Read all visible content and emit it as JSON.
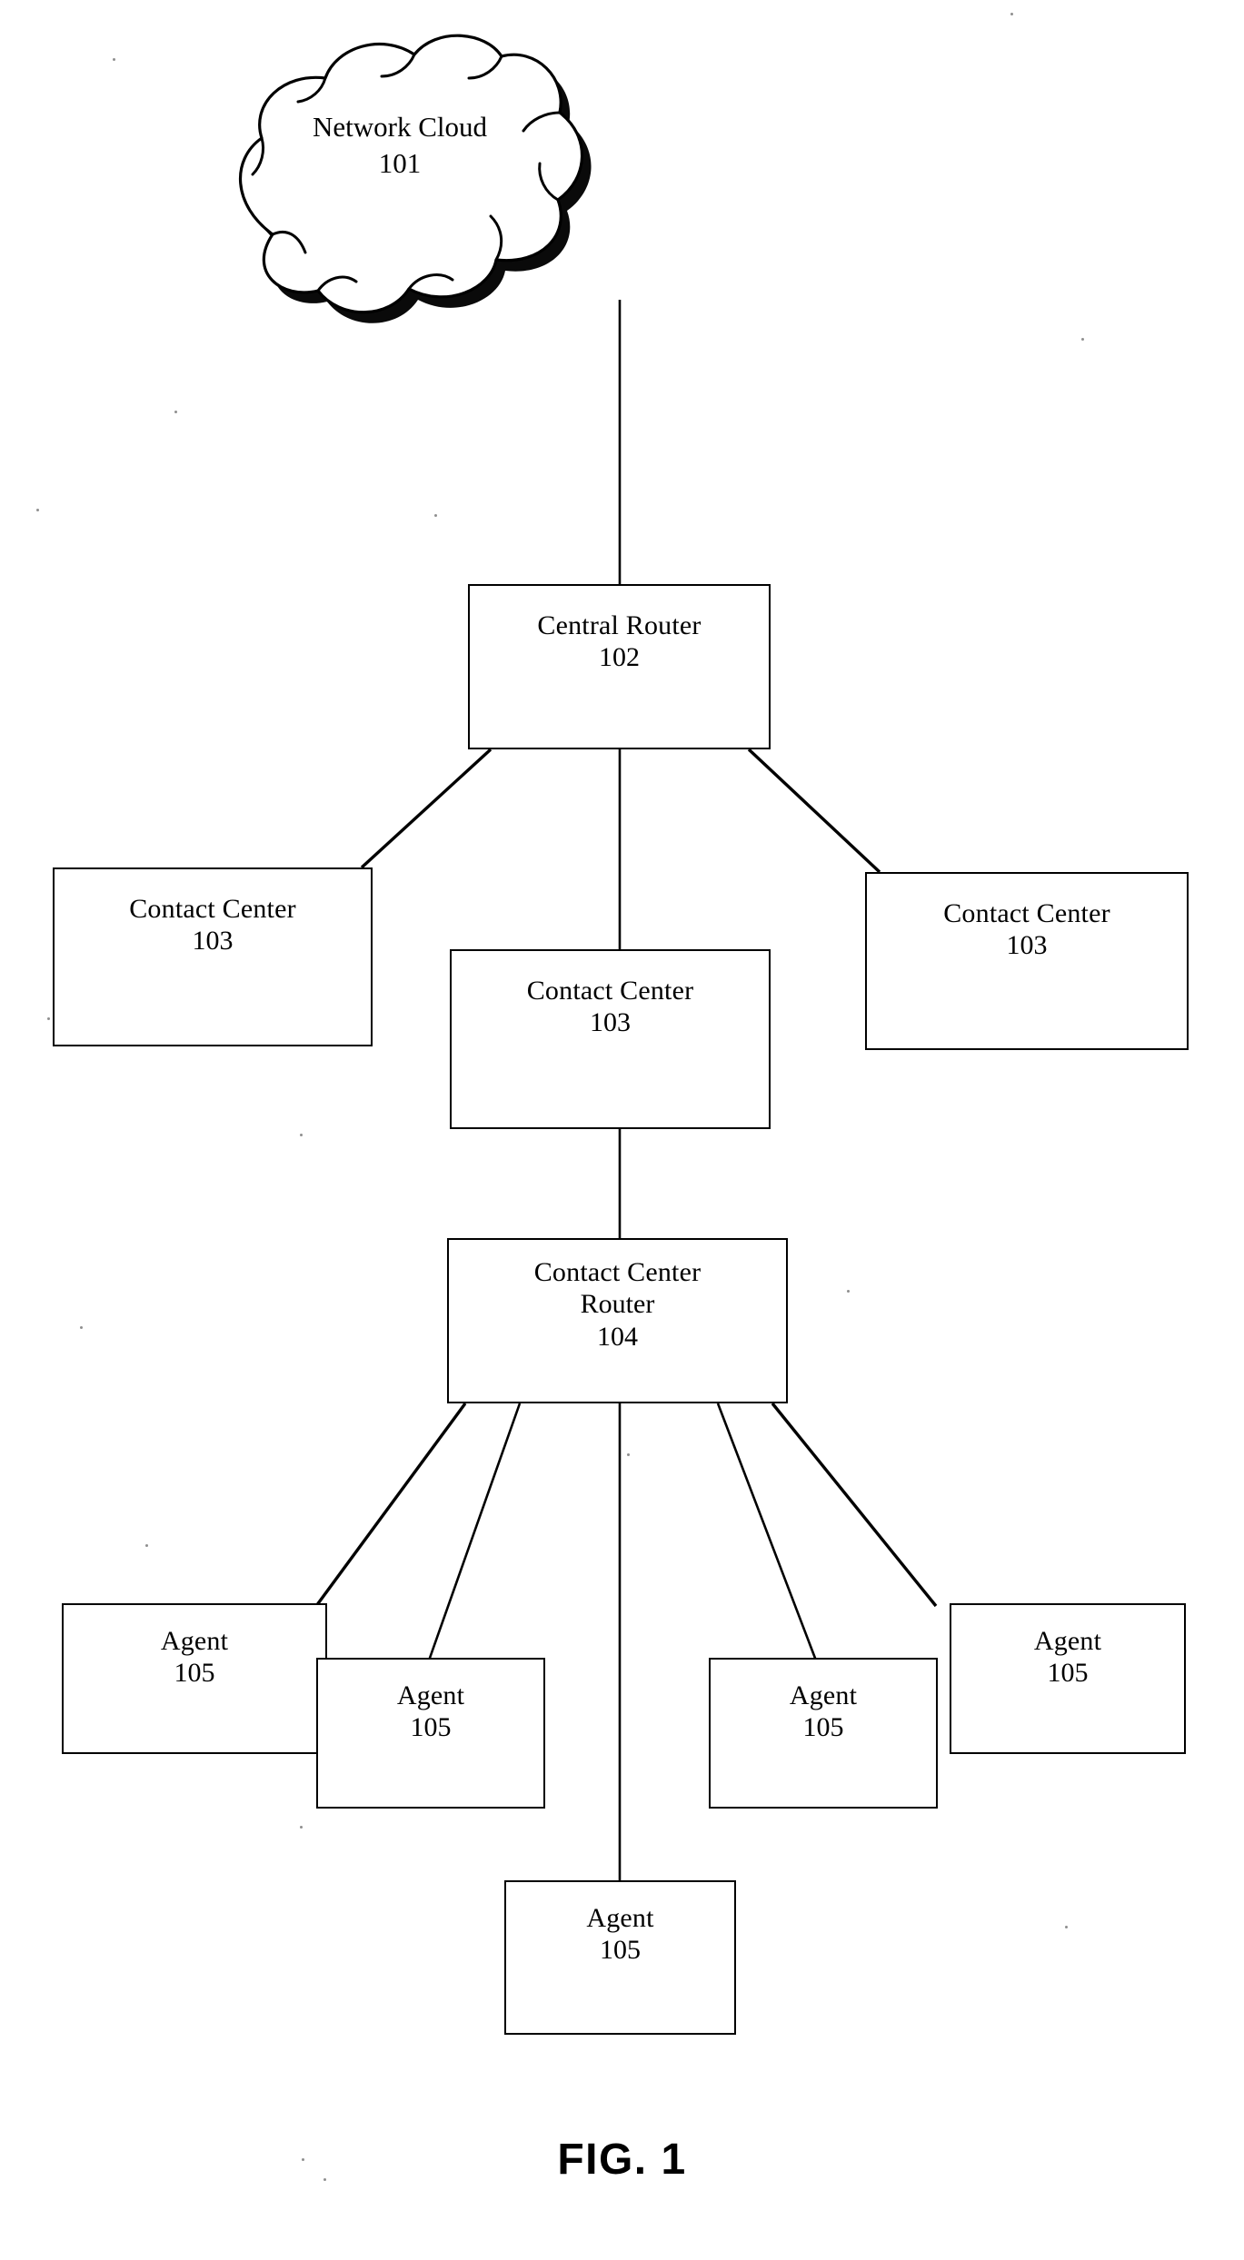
{
  "figure": {
    "caption": "FIG. 1",
    "ink_color": "#000000",
    "background_color": "#ffffff"
  },
  "nodes": {
    "network_cloud": {
      "label": "Network Cloud",
      "ref": "101"
    },
    "central_router": {
      "label": "Central Router",
      "ref": "102"
    },
    "contact_center_left": {
      "label": "Contact Center",
      "ref": "103"
    },
    "contact_center_middle": {
      "label": "Contact Center",
      "ref": "103"
    },
    "contact_center_right": {
      "label": "Contact Center",
      "ref": "103"
    },
    "contact_center_router": {
      "label_line_1": "Contact Center",
      "label_line_2": "Router",
      "ref": "104"
    },
    "agent_1": {
      "label": "Agent",
      "ref": "105"
    },
    "agent_2": {
      "label": "Agent",
      "ref": "105"
    },
    "agent_3": {
      "label": "Agent",
      "ref": "105"
    },
    "agent_4": {
      "label": "Agent",
      "ref": "105"
    },
    "agent_5": {
      "label": "Agent",
      "ref": "105"
    }
  }
}
